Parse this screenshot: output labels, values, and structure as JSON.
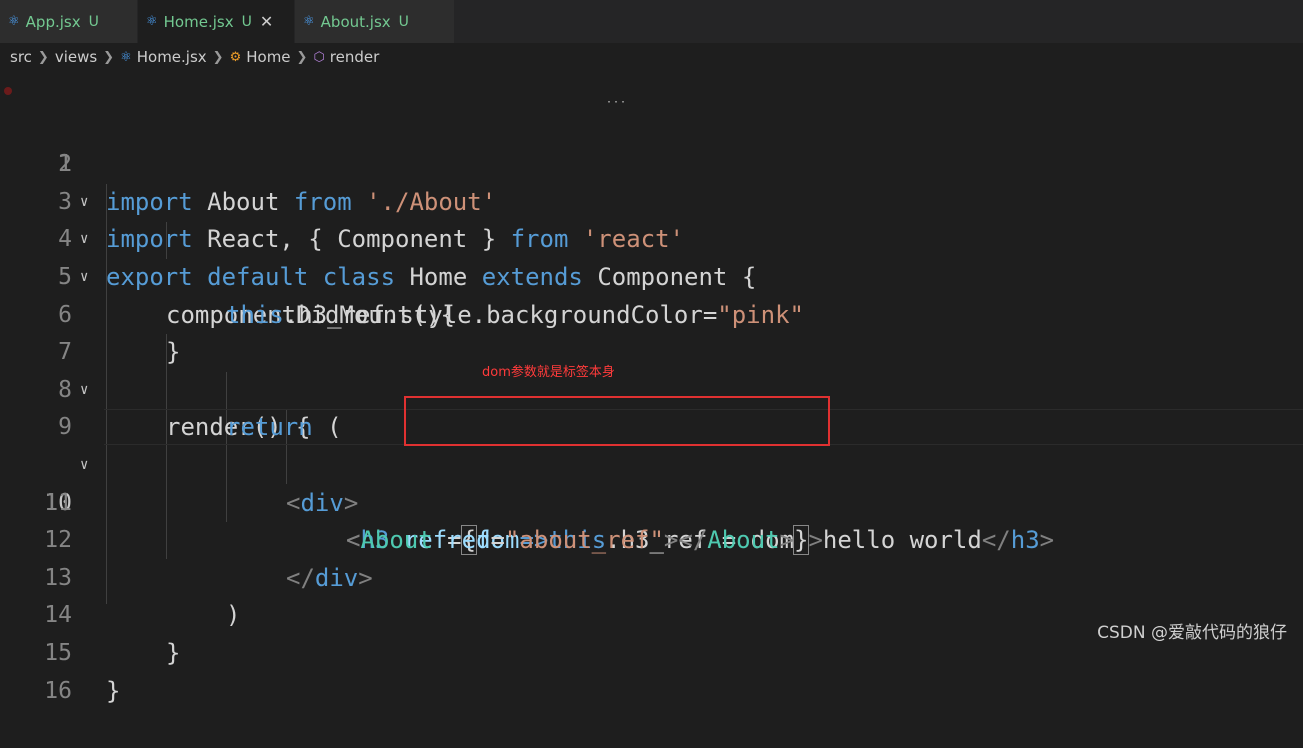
{
  "tabs": [
    {
      "label": "App.jsx",
      "status": "U",
      "active": false
    },
    {
      "label": "Home.jsx",
      "status": "U",
      "active": true,
      "close": "✕"
    },
    {
      "label": "About.jsx",
      "status": "U",
      "active": false
    }
  ],
  "breadcrumb": {
    "items": [
      "src",
      "views",
      "Home.jsx",
      "Home",
      "render"
    ]
  },
  "editor": {
    "line_numbers": [
      "1",
      "2",
      "3",
      "4",
      "5",
      "6",
      "7",
      "8",
      "9",
      "10",
      "11",
      "12",
      "13",
      "14",
      "15",
      "16"
    ],
    "current_line": "10"
  },
  "code": {
    "l1": {
      "import": "import",
      "react_obj": "React, { Component } ",
      "from": "from",
      "src": "'react'"
    },
    "l2": {
      "import": "import",
      "about": "About ",
      "from": "from",
      "src": "'./About'"
    },
    "l3": {
      "export": "export",
      "default": "default",
      "class": "class",
      "name": "Home",
      "extends": "extends",
      "base": "Component",
      "open": "{"
    },
    "l4": {
      "text": "componentDidMount(){"
    },
    "l5": {
      "this": "this",
      "rest": ".h3_ref.style.backgroundColor=",
      "val": "\"pink\""
    },
    "l6": {
      "text": "}"
    },
    "l7": {
      "text": "render() {"
    },
    "l8": {
      "ret": "return",
      "paren": " ("
    },
    "l9": {
      "open": "<",
      "tag": "div",
      "close": ">"
    },
    "l10": {
      "lt": "<",
      "tag": "h3",
      "attr": "ref",
      "eq": "=",
      "lbrace": "{",
      "param": "dom",
      "arrow": "=>",
      "this": "this",
      "rest": ".h3_ref = dom",
      "rbrace": "}",
      "gt": ">",
      "text": "hello world",
      "end_open": "</",
      "end_tag": "h3",
      "end_gt": ">"
    },
    "l11": {
      "lt": "<",
      "tag": "About",
      "attr": "ref",
      "eq": "=",
      "val": "\"about_ref\"",
      "gt": ">",
      "end_open": "</",
      "end_tag": "About",
      "end_gt": ">"
    },
    "l12": {
      "open": "</",
      "tag": "div",
      "close": ">"
    },
    "l13": {
      "text": ")"
    },
    "l14": {
      "text": "}"
    },
    "l15": {
      "text": "}"
    }
  },
  "annotation": {
    "text": "dom参数就是标签本身"
  },
  "watermark": {
    "text": "CSDN @爱敲代码的狼仔"
  },
  "colors": {
    "keyword": "#569cd6",
    "string": "#ce9178",
    "annotation": "#e03131",
    "modified": "#73c991"
  }
}
